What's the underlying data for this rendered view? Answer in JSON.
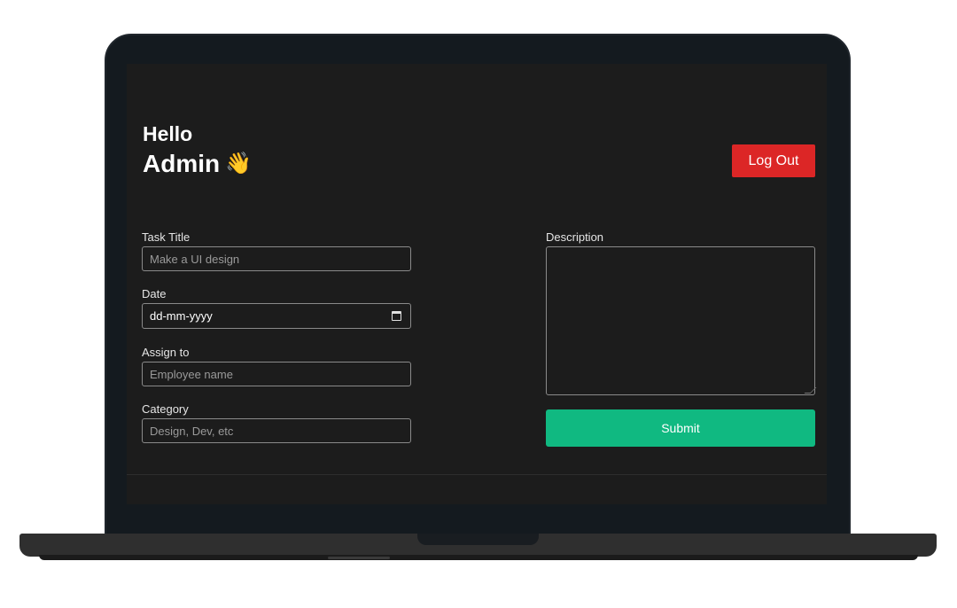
{
  "header": {
    "greeting": "Hello",
    "user_name": "Admin",
    "wave_emoji": "👋",
    "logout_label": "Log Out"
  },
  "form": {
    "task_title": {
      "label": "Task Title",
      "placeholder": "Make a UI design"
    },
    "date": {
      "label": "Date",
      "value": "dd-mm-yyyy"
    },
    "assign_to": {
      "label": "Assign to",
      "placeholder": "Employee name"
    },
    "category": {
      "label": "Category",
      "placeholder": "Design, Dev, etc"
    },
    "description": {
      "label": "Description",
      "value": ""
    },
    "submit_label": "Submit"
  },
  "colors": {
    "background": "#1c1c1c",
    "logout_button": "#dc2626",
    "submit_button": "#10b981",
    "input_border": "#8a8a8a",
    "laptop_frame": "#141a1f"
  },
  "icons": {
    "date_picker": "calendar-icon",
    "greeting": "waving-hand-icon"
  }
}
